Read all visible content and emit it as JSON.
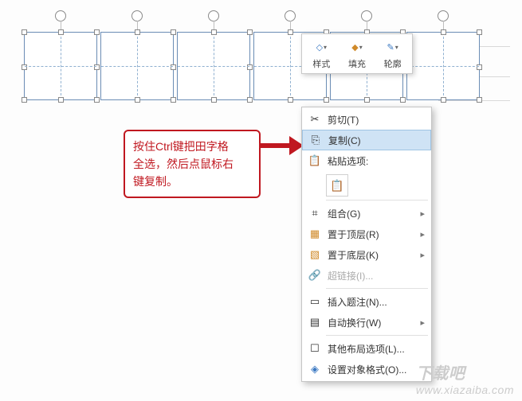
{
  "toolbar": {
    "style": "样式",
    "fill": "填充",
    "outline": "轮廓"
  },
  "menu": {
    "cut": "剪切(T)",
    "copy": "复制(C)",
    "paste_options": "粘贴选项:",
    "group": "组合(G)",
    "bring_front": "置于顶层(R)",
    "send_back": "置于底层(K)",
    "hyperlink": "超链接(I)...",
    "insert_caption": "插入题注(N)...",
    "wrap": "自动换行(W)",
    "more_layout": "其他布局选项(L)...",
    "format_object": "设置对象格式(O)..."
  },
  "callout": {
    "line1": "按住Ctrl键把田字格",
    "line2": "全选，然后点鼠标右",
    "line3": "键复制。"
  },
  "watermark": {
    "brand": "下载吧",
    "url": "www.xiazaiba.com"
  },
  "icons": {
    "cut": "✂",
    "copy": "⎘",
    "paste": "📋",
    "group": "⌗",
    "front": "▦",
    "back": "▧",
    "link": "🔗",
    "caption": "▭",
    "wrap": "▤",
    "layout": "☐",
    "format": "◈",
    "style": "◇",
    "fill": "◆",
    "outline": "✎",
    "arrow": "▸"
  }
}
